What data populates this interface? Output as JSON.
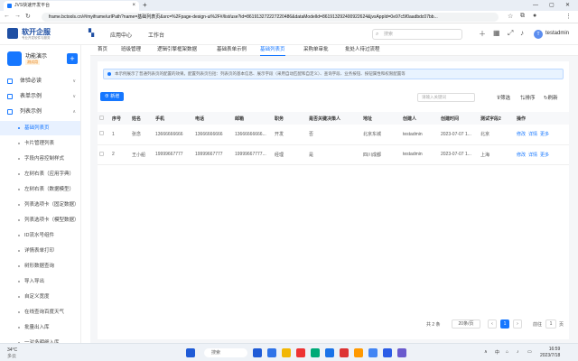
{
  "browser": {
    "tab_title": "JVS快速开发平台",
    "url": "frame.bctools.cn/#/myiframe/urlPath?name=基础列表页&src=%2Fpage-design-ui%2F#/list/use?id=861913272227220486&dataModelId=861913292400922624&jvsAppId=0e97c5f0aadbdc07bb..."
  },
  "header": {
    "logo_title": "软开企服",
    "logo_sub": "专业开发软件与服务",
    "menu": [
      "应用中心",
      "工作台"
    ],
    "search_placeholder": "搜索",
    "avatar_letter": "T",
    "username": "testadmin"
  },
  "sidebar": {
    "app_name": "功能演示",
    "app_tag": "测试用",
    "groups": [
      {
        "label": "体验必读",
        "expanded": false
      },
      {
        "label": "表单示例",
        "expanded": false
      },
      {
        "label": "列表示例",
        "expanded": true
      }
    ],
    "items": [
      "基础列表页",
      "卡片管理列表",
      "字段内容控制样式",
      "左树右表（应用字典）",
      "左树右表（数据模型）",
      "列表选项卡（固定数据）",
      "列表选项卡（模型数据）",
      "ID流水号组件",
      "详情表单打印",
      "树形数据查询",
      "导入导出",
      "自定义宽度",
      "在线查询百度天气",
      "批量出入库",
      "一对多明细入库"
    ],
    "active_item": 0
  },
  "page_tabs": {
    "items": [
      "首页",
      "班级管理",
      "逻辑引擎框架数据",
      "基础表单示例",
      "基础列表页",
      "采购单审批",
      "批处人待过流程"
    ],
    "active": 4
  },
  "main": {
    "notice": "本示例展示了普通列表页的配置的效果。配置列表页包括：列表页的基本信息、展示字段（采用自动匹配和自定义）、查询字段、业务按钮、按钮属性和权限配置等",
    "add_button": "新增",
    "search_placeholder": "请输入关键词",
    "tools": [
      "筛选",
      "排序",
      "刷新"
    ],
    "columns": [
      "",
      "序号",
      "姓名",
      "手机",
      "电话",
      "邮箱",
      "职务",
      "是否关键决策人",
      "地址",
      "创建人",
      "创建时间",
      "测试字段2",
      "操作"
    ],
    "rows": [
      {
        "index": "1",
        "name": "张念",
        "mobile": "13666666666",
        "phone": "13666666666",
        "email": "13666666666...",
        "title": "开发",
        "key": "否",
        "address": "北京东城",
        "creator": "testadmin",
        "created": "2023-07-07 1...",
        "test": "北京",
        "actions": [
          "修改",
          "详情",
          "更多"
        ]
      },
      {
        "index": "2",
        "name": "王小船",
        "mobile": "19999667777",
        "phone": "19999667777",
        "email": "19999667777...",
        "title": "经理",
        "key": "是",
        "address": "四川成都",
        "creator": "testadmin",
        "created": "2023-07-07 1...",
        "test": "上海",
        "actions": [
          "修改",
          "详情",
          "更多"
        ]
      }
    ],
    "pagination": {
      "total": "共 2 条",
      "page_size": "20条/页",
      "current": "1",
      "goto_label": "前往",
      "goto_value": "1",
      "page_unit": "页"
    }
  },
  "taskbar": {
    "temp": "34°C",
    "weather": "多云",
    "search": "搜索",
    "lang": "中",
    "time": "16:59",
    "date": "2023/7/18",
    "app_colors": [
      "#1f5bd6",
      "#2f73e8",
      "#f2b705",
      "#e33",
      "#0a7",
      "#1a73e8",
      "#d33",
      "#f90",
      "#4285f4",
      "#2b5ce6",
      "#6a5acd"
    ]
  }
}
